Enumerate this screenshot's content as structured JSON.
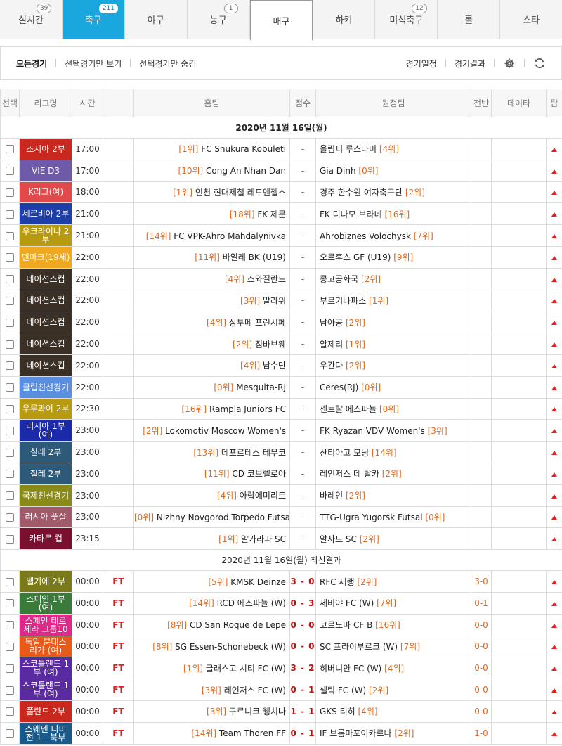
{
  "tabs": [
    {
      "label": "실시간",
      "badge": "39"
    },
    {
      "label": "축구",
      "badge": "211"
    },
    {
      "label": "야구",
      "badge": ""
    },
    {
      "label": "농구",
      "badge": "1"
    },
    {
      "label": "배구",
      "badge": ""
    },
    {
      "label": "하키",
      "badge": ""
    },
    {
      "label": "미식축구",
      "badge": "12"
    },
    {
      "label": "롤",
      "badge": ""
    },
    {
      "label": "스타",
      "badge": ""
    }
  ],
  "toolbar": {
    "all_games": "모든경기",
    "show_selected": "선택경기만 보기",
    "hide_selected": "선택경기만 숨김",
    "schedule": "경기일정",
    "results": "경기결과"
  },
  "columns": [
    "선택",
    "리그명",
    "시간",
    "",
    "홈팀",
    "점수",
    "원정팀",
    "전반",
    "데이타",
    "탑"
  ],
  "colors": {
    "accent": "#1aa7dd",
    "rank": "#e06a20",
    "live": "#e02020"
  },
  "date1": "2020년 11월 16일(월)",
  "date2": "2020년 11월 16일(월) 최신결과",
  "upcoming": [
    {
      "league": "조지아 2부",
      "color": "#c8281e",
      "time": "17:00",
      "home_rank": "[1위]",
      "home": "FC Shukura Kobuleti",
      "score": "-",
      "away": "올림피 루스타비",
      "away_rank": "[4위]"
    },
    {
      "league": "VIE D3",
      "color": "#6e5aa8",
      "time": "17:00",
      "home_rank": "[10위]",
      "home": "Cong An Nhan Dan",
      "score": "-",
      "away": "Gia Dinh",
      "away_rank": "[0위]"
    },
    {
      "league": "K리그(여)",
      "color": "#e04a4a",
      "time": "18:00",
      "home_rank": "[1위]",
      "home": "인천 현대제철 레드엔젤스",
      "score": "-",
      "away": "경주 한수원 여자축구단",
      "away_rank": "[2위]"
    },
    {
      "league": "세르비아 2부",
      "color": "#1e3ea8",
      "time": "21:00",
      "home_rank": "[18위]",
      "home": "FK 제문",
      "score": "-",
      "away": "FK 디나모 브라네",
      "away_rank": "[16위]"
    },
    {
      "league": "우크라이나 2부",
      "color": "#b89a10",
      "time": "21:00",
      "home_rank": "[14위]",
      "home": "FC VPK-Ahro Mahdalynivka",
      "score": "-",
      "away": "Ahrobiznes Volochysk",
      "away_rank": "[7위]"
    },
    {
      "league": "덴마크(19세)",
      "color": "#f0a820",
      "time": "22:00",
      "home_rank": "[11위]",
      "home": "바일레 BK (U19)",
      "score": "-",
      "away": "오르후스 GF (U19)",
      "away_rank": "[9위]"
    },
    {
      "league": "네이션스컵",
      "color": "#3a3026",
      "time": "22:00",
      "home_rank": "[4위]",
      "home": "스와질란드",
      "score": "-",
      "away": "콩고공화국",
      "away_rank": "[2위]"
    },
    {
      "league": "네이션스컵",
      "color": "#3a3026",
      "time": "22:00",
      "home_rank": "[3위]",
      "home": "말라위",
      "score": "-",
      "away": "부르키나파소",
      "away_rank": "[1위]"
    },
    {
      "league": "네이션스컵",
      "color": "#3a3026",
      "time": "22:00",
      "home_rank": "[4위]",
      "home": "상투메 프린시페",
      "score": "-",
      "away": "남아공",
      "away_rank": "[2위]"
    },
    {
      "league": "네이션스컵",
      "color": "#3a3026",
      "time": "22:00",
      "home_rank": "[2위]",
      "home": "짐바브웨",
      "score": "-",
      "away": "알제리",
      "away_rank": "[1위]"
    },
    {
      "league": "네이션스컵",
      "color": "#3a3026",
      "time": "22:00",
      "home_rank": "[4위]",
      "home": "남수단",
      "score": "-",
      "away": "우간다",
      "away_rank": "[2위]"
    },
    {
      "league": "클럽친선경기",
      "color": "#5a8ee0",
      "time": "22:00",
      "home_rank": "[0위]",
      "home": "Mesquita-RJ",
      "score": "-",
      "away": "Ceres(RJ)",
      "away_rank": "[0위]"
    },
    {
      "league": "우루과이 2부",
      "color": "#b89a10",
      "time": "22:30",
      "home_rank": "[16위]",
      "home": "Rampla Juniors FC",
      "score": "-",
      "away": "센트랄 에스파뇰",
      "away_rank": "[0위]"
    },
    {
      "league": "러시아 1부(여)",
      "color": "#1a2aa8",
      "time": "23:00",
      "home_rank": "[2위]",
      "home": "Lokomotiv Moscow Women's",
      "score": "-",
      "away": "FK Ryazan VDV Women's",
      "away_rank": "[3위]"
    },
    {
      "league": "칠레 2부",
      "color": "#2e5a7a",
      "time": "23:00",
      "home_rank": "[13위]",
      "home": "데포르테스 테무코",
      "score": "-",
      "away": "산티아고 모닝",
      "away_rank": "[14위]"
    },
    {
      "league": "칠레 2부",
      "color": "#2e5a7a",
      "time": "23:00",
      "home_rank": "[11위]",
      "home": "CD 코브렐로아",
      "score": "-",
      "away": "레인저스 데 탈카",
      "away_rank": "[2위]"
    },
    {
      "league": "국제친선경기",
      "color": "#8a8a18",
      "time": "23:00",
      "home_rank": "[4위]",
      "home": "아랍에미리트",
      "score": "-",
      "away": "바레인",
      "away_rank": "[2위]"
    },
    {
      "league": "러시아 풋살",
      "color": "#a05a6a",
      "time": "23:00",
      "home_rank": "[0위]",
      "home": "Nizhny Novgorod Torpedo Futsal",
      "score": "-",
      "away": "TTG-Ugra Yugorsk Futsal",
      "away_rank": "[0위]"
    },
    {
      "league": "카타르 컵",
      "color": "#7a1030",
      "time": "23:15",
      "home_rank": "[1위]",
      "home": "알가라파 SC",
      "score": "-",
      "away": "알사드 SC",
      "away_rank": "[2위]"
    }
  ],
  "results": [
    {
      "league": "벨기에 2부",
      "color": "#7a7a1a",
      "time": "00:00",
      "status": "FT",
      "home_rank": "[5위]",
      "home": "KMSK Deinze",
      "score": "3 - 0",
      "away": "RFC 세랭",
      "away_rank": "[2위]",
      "half": "3-0"
    },
    {
      "league": "스페인 1부(여)",
      "color": "#3a7a3a",
      "time": "00:00",
      "status": "FT",
      "home_rank": "[14위]",
      "home": "RCD 에스파뇰 (W)",
      "score": "0 - 3",
      "away": "세비야 FC (W)",
      "away_rank": "[7위]",
      "half": "0-1"
    },
    {
      "league": "스페인 테르세라 그룹10",
      "color": "#e0288a",
      "time": "00:00",
      "status": "FT",
      "home_rank": "[8위]",
      "home": "CD San Roque de Lepe",
      "score": "0 - 0",
      "away": "코르도바 CF B",
      "away_rank": "[16위]",
      "half": "0-0"
    },
    {
      "league": "독일 분데스리가 (여)",
      "color": "#e85a1a",
      "time": "00:00",
      "status": "FT",
      "home_rank": "[8위]",
      "home": "SG Essen-Schonebeck (W)",
      "score": "0 - 0",
      "away": "SC 프라이부르크 (W)",
      "away_rank": "[7위]",
      "half": "0-0"
    },
    {
      "league": "스코틀랜드 1부 (여)",
      "color": "#5a2aa0",
      "time": "00:00",
      "status": "FT",
      "home_rank": "[1위]",
      "home": "글래스고 시티 FC (W)",
      "score": "3 - 2",
      "away": "히버니안 FC (W)",
      "away_rank": "[4위]",
      "half": "0-0"
    },
    {
      "league": "스코틀랜드 1부 (여)",
      "color": "#5a2aa0",
      "time": "00:00",
      "status": "FT",
      "home_rank": "[3위]",
      "home": "레인저스 FC (W)",
      "score": "0 - 1",
      "away": "셀틱 FC (W)",
      "away_rank": "[2위]",
      "half": "0-0"
    },
    {
      "league": "폴란드 2부",
      "color": "#c8281e",
      "time": "00:00",
      "status": "FT",
      "home_rank": "[3위]",
      "home": "구르니크 웽치나",
      "score": "1 - 1",
      "away": "GKS 티히",
      "away_rank": "[4위]",
      "half": "0-0"
    },
    {
      "league": "스웨덴 디비전 1 - 북부",
      "color": "#1a5a8a",
      "time": "00:00",
      "status": "FT",
      "home_rank": "[14위]",
      "home": "Team Thoren FF",
      "score": "0 - 1",
      "away": "IF 브롬마포이카르나",
      "away_rank": "[2위]",
      "half": "1-0"
    }
  ]
}
